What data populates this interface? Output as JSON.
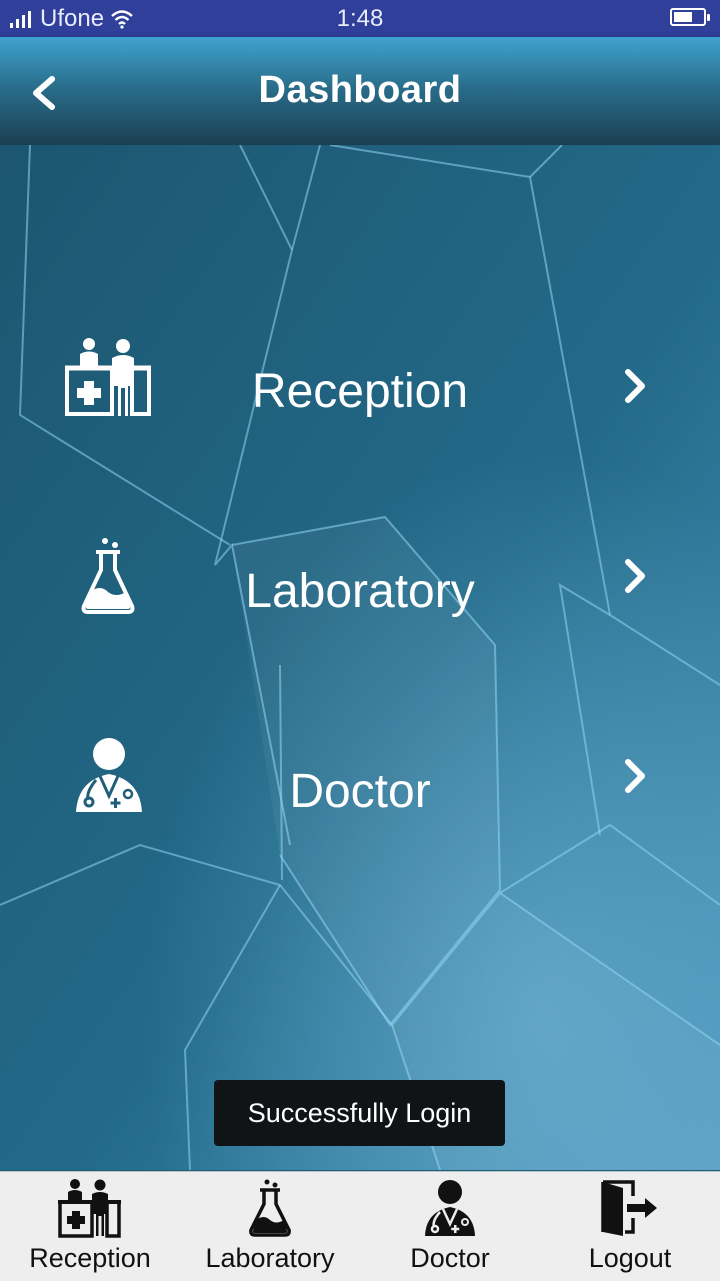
{
  "status_bar": {
    "carrier": "Ufone",
    "time": "1:48"
  },
  "header": {
    "title": "Dashboard",
    "back_icon": "chevron-left-icon"
  },
  "menu": [
    {
      "label": "Reception",
      "icon": "reception-desk-icon"
    },
    {
      "label": "Laboratory",
      "icon": "flask-icon"
    },
    {
      "label": "Doctor",
      "icon": "doctor-icon"
    }
  ],
  "toast": {
    "message": "Successfully Login"
  },
  "bottom_nav": [
    {
      "label": "Reception",
      "icon": "reception-desk-icon"
    },
    {
      "label": "Laboratory",
      "icon": "flask-icon"
    },
    {
      "label": "Doctor",
      "icon": "doctor-icon"
    },
    {
      "label": "Logout",
      "icon": "logout-door-icon"
    }
  ],
  "colors": {
    "status_bar": "#2f3f9a",
    "header_top": "#3fa3cf",
    "header_bottom": "#1b3f52",
    "background": "#1f5f7a",
    "toast": "#101417",
    "bottom_nav": "#eeeeee"
  }
}
